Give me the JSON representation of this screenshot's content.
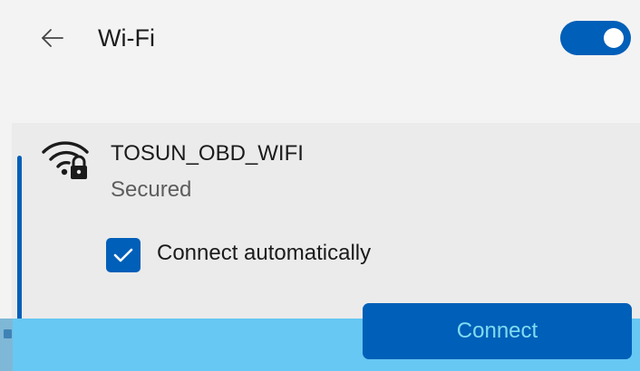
{
  "header": {
    "back_icon": "back-arrow-icon",
    "title": "Wi-Fi",
    "wifi_toggle": {
      "state": "on"
    }
  },
  "network": {
    "signal_icon": "wifi-secured-icon",
    "name": "TOSUN_OBD_WIFI",
    "status": "Secured",
    "connect_automatically": {
      "checked": true,
      "label": "Connect automatically",
      "icon": "checkmark-icon"
    },
    "connect_button_label": "Connect"
  },
  "colors": {
    "accent": "#005fb8",
    "background": "#f3f3f3",
    "card": "#ebebeb",
    "taskbar": "#66c8f3",
    "button_text": "#7fdcf0"
  }
}
